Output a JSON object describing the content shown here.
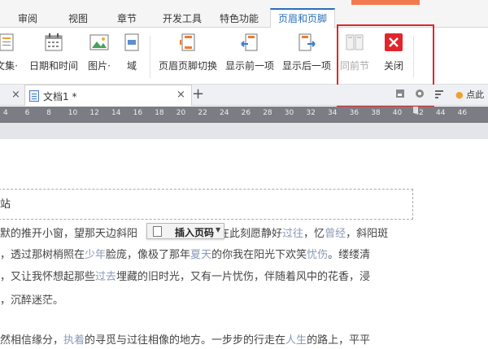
{
  "tabs": [
    {
      "label": "审阅",
      "active": false
    },
    {
      "label": "视图",
      "active": false
    },
    {
      "label": "章节",
      "active": false
    },
    {
      "label": "开发工具",
      "active": false
    },
    {
      "label": "特色功能",
      "active": false
    },
    {
      "label": "页眉和页脚",
      "active": true
    }
  ],
  "ribbon": {
    "buttons": [
      {
        "label": "文集·",
        "icon": "doc-parts-icon"
      },
      {
        "label": "日期和时间",
        "icon": "calendar-icon"
      },
      {
        "label": "图片·",
        "icon": "picture-icon"
      },
      {
        "label": "域",
        "icon": "field-icon"
      },
      {
        "label": "页眉页脚切换",
        "icon": "header-footer-switch-icon"
      },
      {
        "label": "显示前一项",
        "icon": "show-previous-icon"
      },
      {
        "label": "显示后一项",
        "icon": "show-next-icon"
      },
      {
        "label": "同前节",
        "icon": "same-as-previous-icon",
        "disabled": true
      },
      {
        "label": "关闭",
        "icon": "close-icon"
      }
    ]
  },
  "docbar": {
    "doc_name": "文档1 *",
    "close_glyph": "×",
    "left_close_glyph": "×",
    "add_glyph": "+",
    "tip_text": "点此"
  },
  "ruler": {
    "ticks": [
      "4",
      "6",
      "8",
      "10",
      "12",
      "14",
      "16",
      "18",
      "20",
      "22",
      "24",
      "26",
      "28",
      "30",
      "32",
      "34",
      "36",
      "38",
      "40",
      "42",
      "44",
      "46"
    ]
  },
  "document": {
    "header_text": "站",
    "insert_page_number_label": "插入页码",
    "lines": [
      {
        "pre": "默的推开小窗，望那天边斜阳",
        "mid": "",
        "post": "在此刻愿静好",
        "link1": "过往",
        "rest1": "，忆",
        "link2": "曾经",
        "rest2": "，斜阳斑"
      },
      {
        "pre": "，透过那树梢照在",
        "mid": "少年",
        "post": "脸庞，像极了那年",
        "link1": "夏天",
        "rest1": "的你我在阳光下欢笑",
        "link2": "忧伤",
        "rest2": "。缕缕清"
      },
      {
        "pre": "，又让我怀想起那些",
        "mid": "过去",
        "post": "埋藏的旧时光，又有一片忧伤，伴随着风中的花香，浸",
        "link1": "",
        "rest1": "",
        "link2": "",
        "rest2": ""
      },
      {
        "pre": "，沉醉迷茫。",
        "mid": "",
        "post": "",
        "link1": "",
        "rest1": "",
        "link2": "",
        "rest2": ""
      },
      {
        "pre": "然相信缘分，",
        "mid": "执着",
        "post": "的寻觅与过往相像的地方。一步步的行走在",
        "link1": "人生",
        "rest1": "的路上，平平",
        "link2": "",
        "rest2": ""
      }
    ]
  },
  "colors": {
    "active_tab": "#2b6fb8",
    "highlight_box": "#e0262c",
    "close_button": "#e0262c",
    "accent_orange": "#f27a4f"
  }
}
